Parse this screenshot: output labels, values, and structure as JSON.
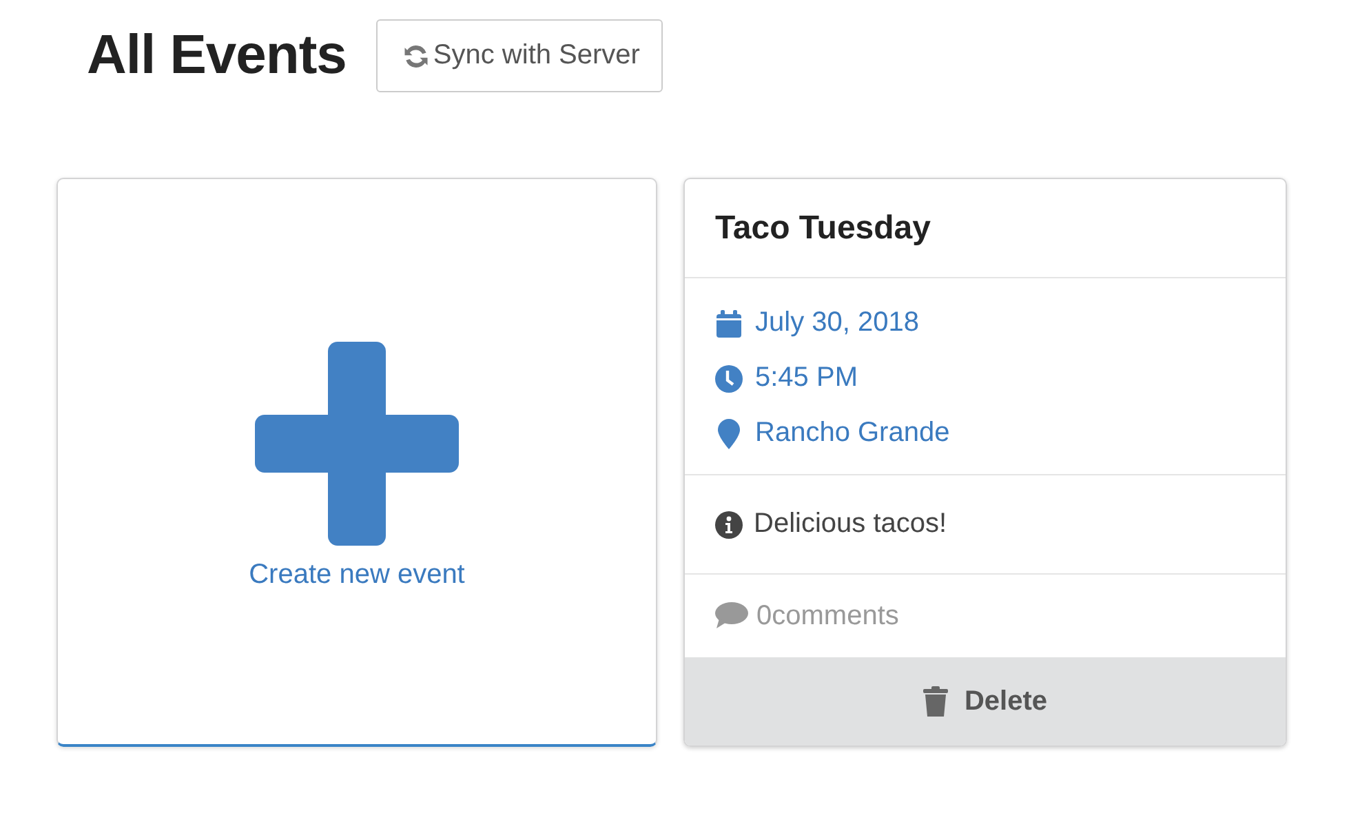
{
  "page": {
    "title": "All Events",
    "sync_button": "Sync with Server"
  },
  "create_card": {
    "label": "Create new event"
  },
  "events": [
    {
      "title": "Taco Tuesday",
      "details": [
        {
          "kind": "date",
          "text": "July 30, 2018"
        },
        {
          "kind": "time",
          "text": "5:45 PM"
        },
        {
          "kind": "location",
          "text": "Rancho Grande"
        }
      ],
      "description": "Delicious tacos!",
      "comments": "0comments",
      "delete_button": "Delete"
    }
  ]
}
